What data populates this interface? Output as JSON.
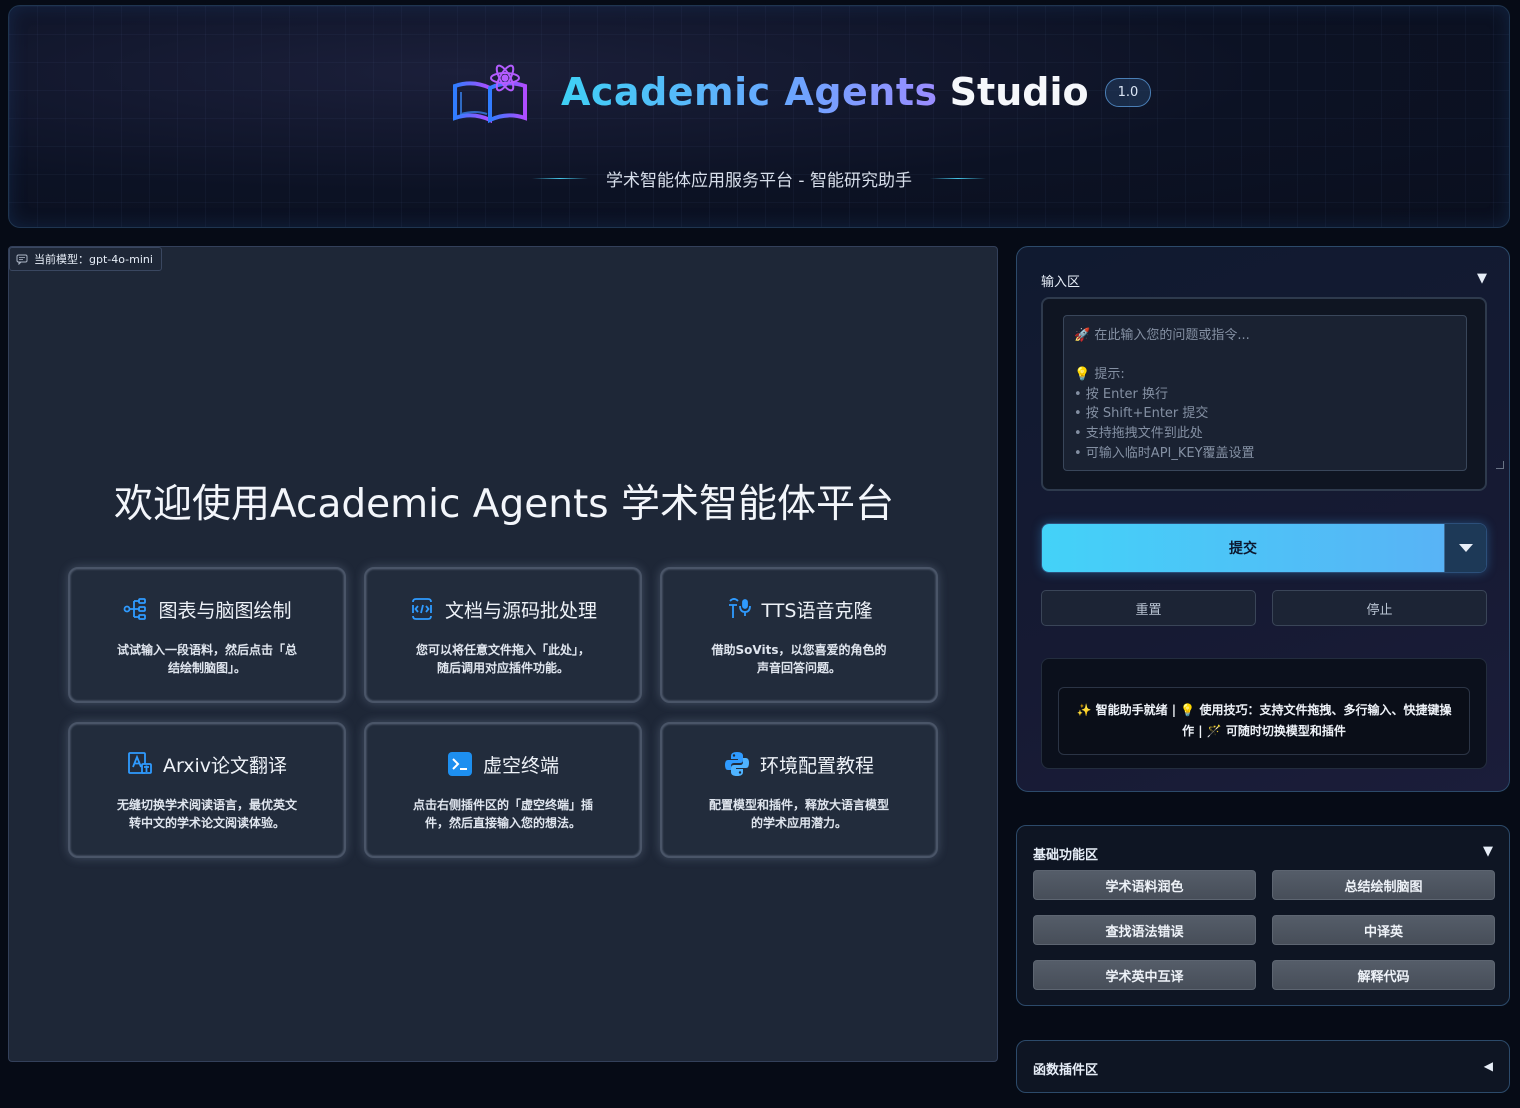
{
  "header": {
    "title_part1": "Academic Agents",
    "title_part2": "Studio",
    "version": "1.0",
    "subtitle": "学术智能体应用服务平台 - 智能研究助手",
    "logo_icon": "book-atom-logo-icon"
  },
  "chat": {
    "model_tag": "当前模型：gpt-4o-mini",
    "welcome": "欢迎使用Academic Agents 学术智能体平台",
    "cards": [
      {
        "icon": "mindmap-icon",
        "title": "图表与脑图绘制",
        "desc": "试试输入一段语料，然后点击「总结绘制脑图」。"
      },
      {
        "icon": "document-code-icon",
        "title": "文档与源码批处理",
        "desc": "您可以将任意文件拖入「此处」，随后调用对应插件功能。"
      },
      {
        "icon": "tts-voice-icon",
        "title": "TTS语音克隆",
        "desc": "借助SoVits，以您喜爱的角色的声音回答问题。"
      },
      {
        "icon": "translate-icon",
        "title": "Arxiv论文翻译",
        "desc": "无缝切换学术阅读语言，最优英文转中文的学术论文阅读体验。"
      },
      {
        "icon": "terminal-icon",
        "title": "虚空终端",
        "desc": "点击右侧插件区的「虚空终端」插件，然后直接输入您的想法。"
      },
      {
        "icon": "python-icon",
        "title": "环境配置教程",
        "desc": "配置模型和插件，释放大语言模型的学术应用潜力。"
      }
    ]
  },
  "input_panel": {
    "label": "输入区",
    "toggle": "▼",
    "placeholder": "🚀 在此输入您的问题或指令...\n\n💡 提示:\n• 按 Enter 换行\n• 按 Shift+Enter 提交\n• 支持拖拽文件到此处\n• 可输入临时API_KEY覆盖设置",
    "submit_label": "提交",
    "reset_label": "重置",
    "stop_label": "停止",
    "status": "✨ 智能助手就绪 | 💡 使用技巧：支持文件拖拽、多行输入、快捷键操作 | 🪄 可随时切换模型和插件"
  },
  "basic_panel": {
    "label": "基础功能区",
    "toggle": "▼",
    "buttons": [
      "学术语料润色",
      "总结绘制脑图",
      "查找语法错误",
      "中译英",
      "学术英中互译",
      "解释代码"
    ]
  },
  "plugin_panel": {
    "label": "函数插件区",
    "toggle": "◀"
  },
  "colors": {
    "accent_cyan": "#43d2f8",
    "accent_blue": "#58b3f6",
    "panel_bg": "#1e2737",
    "page_bg": "#060b16"
  }
}
